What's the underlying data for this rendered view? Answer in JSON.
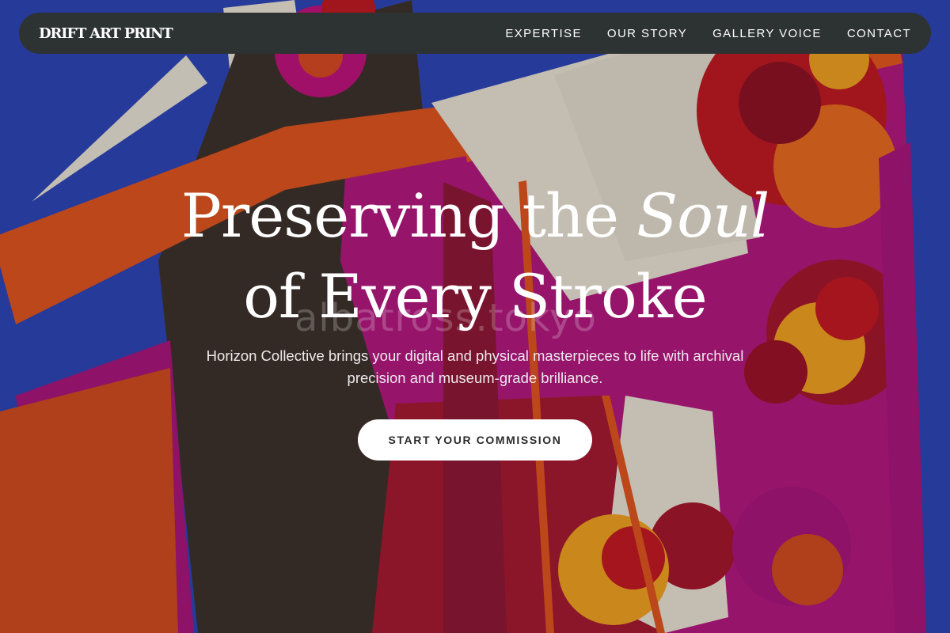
{
  "brand": {
    "name": "DRIFT ART PRINT"
  },
  "nav": {
    "links": [
      {
        "label": "EXPERTISE"
      },
      {
        "label": "OUR STORY"
      },
      {
        "label": "GALLERY VOICE"
      },
      {
        "label": "CONTACT"
      }
    ]
  },
  "hero": {
    "title_part1": "Preserving the",
    "title_emphasis": "Soul",
    "title_line2": "of Every Stroke",
    "subtitle": "Horizon Collective brings your digital and physical masterpieces to life with archival precision and museum-grade brilliance.",
    "cta_label": "START YOUR COMMISSION"
  },
  "background": {
    "watermark_text": "albatross.tokyo",
    "artwork_colors": {
      "blue": "#2a44b8",
      "magenta": "#b4157e",
      "crimson": "#a5172e",
      "orange": "#e0541c",
      "yellow": "#f2a21e",
      "cream": "#ece6d6",
      "dark": "#3b3029"
    }
  },
  "colors": {
    "navbar_bg": "#2d3232",
    "nav_text": "#ffffff",
    "button_bg": "#ffffff",
    "button_text": "#2b2b2b"
  }
}
